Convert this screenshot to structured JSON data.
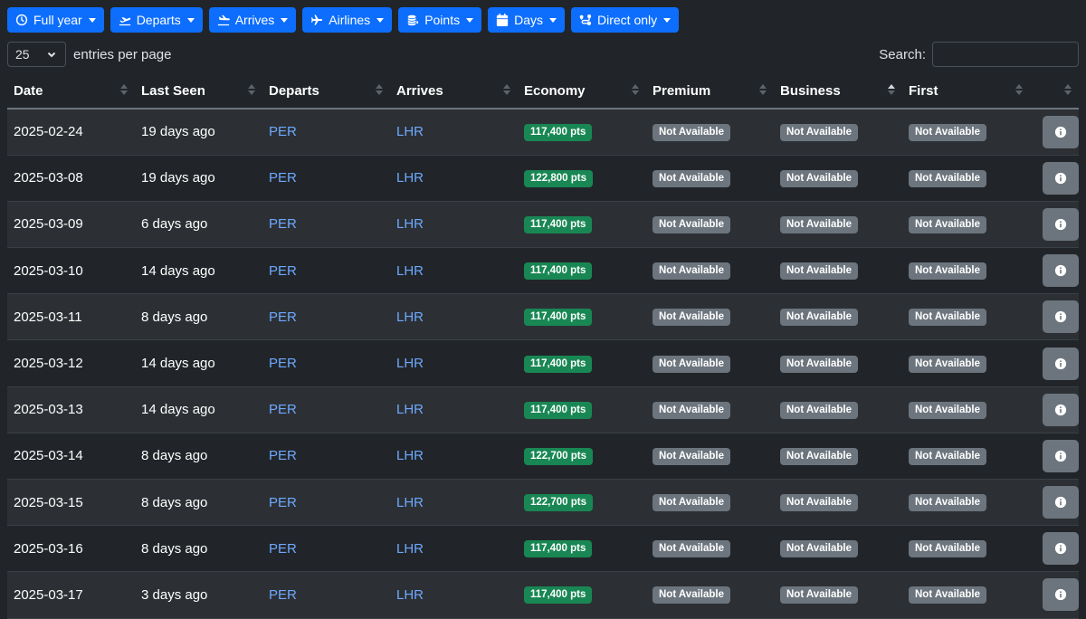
{
  "filters": [
    {
      "label": "Full year",
      "icon": "clock-icon"
    },
    {
      "label": "Departs",
      "icon": "plane-departure-icon"
    },
    {
      "label": "Arrives",
      "icon": "plane-arrival-icon"
    },
    {
      "label": "Airlines",
      "icon": "plane-icon"
    },
    {
      "label": "Points",
      "icon": "coins-icon"
    },
    {
      "label": "Days",
      "icon": "calendar-icon"
    },
    {
      "label": "Direct only",
      "icon": "route-icon"
    }
  ],
  "length": {
    "value": "25",
    "label": "entries per page"
  },
  "search": {
    "label": "Search:",
    "value": "",
    "placeholder": ""
  },
  "table": {
    "columns": [
      "Date",
      "Last Seen",
      "Departs",
      "Arrives",
      "Economy",
      "Premium",
      "Business",
      "First",
      ""
    ],
    "sorted_column": "Business",
    "rows": [
      {
        "date": "2025-02-24",
        "last_seen": "19 days ago",
        "departs": "PER",
        "arrives": "LHR",
        "economy": "117,400 pts",
        "premium": "Not Available",
        "business": "Not Available",
        "first": "Not Available"
      },
      {
        "date": "2025-03-08",
        "last_seen": "19 days ago",
        "departs": "PER",
        "arrives": "LHR",
        "economy": "122,800 pts",
        "premium": "Not Available",
        "business": "Not Available",
        "first": "Not Available"
      },
      {
        "date": "2025-03-09",
        "last_seen": "6 days ago",
        "departs": "PER",
        "arrives": "LHR",
        "economy": "117,400 pts",
        "premium": "Not Available",
        "business": "Not Available",
        "first": "Not Available"
      },
      {
        "date": "2025-03-10",
        "last_seen": "14 days ago",
        "departs": "PER",
        "arrives": "LHR",
        "economy": "117,400 pts",
        "premium": "Not Available",
        "business": "Not Available",
        "first": "Not Available"
      },
      {
        "date": "2025-03-11",
        "last_seen": "8 days ago",
        "departs": "PER",
        "arrives": "LHR",
        "economy": "117,400 pts",
        "premium": "Not Available",
        "business": "Not Available",
        "first": "Not Available"
      },
      {
        "date": "2025-03-12",
        "last_seen": "14 days ago",
        "departs": "PER",
        "arrives": "LHR",
        "economy": "117,400 pts",
        "premium": "Not Available",
        "business": "Not Available",
        "first": "Not Available"
      },
      {
        "date": "2025-03-13",
        "last_seen": "14 days ago",
        "departs": "PER",
        "arrives": "LHR",
        "economy": "117,400 pts",
        "premium": "Not Available",
        "business": "Not Available",
        "first": "Not Available"
      },
      {
        "date": "2025-03-14",
        "last_seen": "8 days ago",
        "departs": "PER",
        "arrives": "LHR",
        "economy": "122,700 pts",
        "premium": "Not Available",
        "business": "Not Available",
        "first": "Not Available"
      },
      {
        "date": "2025-03-15",
        "last_seen": "8 days ago",
        "departs": "PER",
        "arrives": "LHR",
        "economy": "122,700 pts",
        "premium": "Not Available",
        "business": "Not Available",
        "first": "Not Available"
      },
      {
        "date": "2025-03-16",
        "last_seen": "8 days ago",
        "departs": "PER",
        "arrives": "LHR",
        "economy": "117,400 pts",
        "premium": "Not Available",
        "business": "Not Available",
        "first": "Not Available"
      },
      {
        "date": "2025-03-17",
        "last_seen": "3 days ago",
        "departs": "PER",
        "arrives": "LHR",
        "economy": "117,400 pts",
        "premium": "Not Available",
        "business": "Not Available",
        "first": "Not Available"
      }
    ]
  },
  "colors": {
    "background": "#212529",
    "accent": "#0d6efd",
    "link": "#6ea8fe",
    "success": "#198754",
    "secondary": "#6c757d"
  }
}
